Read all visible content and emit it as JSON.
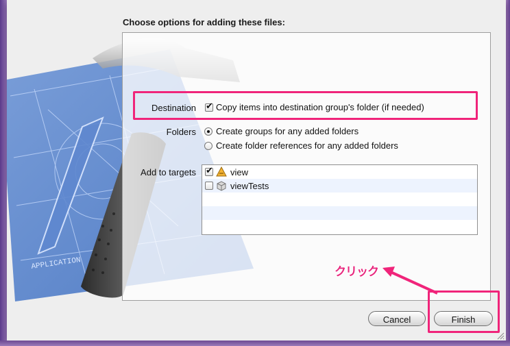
{
  "dialog": {
    "heading": "Choose options for adding these files:"
  },
  "destination": {
    "label": "Destination",
    "checkbox_label": "Copy items into destination group's folder (if needed)",
    "checked": true
  },
  "folders": {
    "label": "Folders",
    "options": [
      {
        "label": "Create groups for any added folders",
        "selected": true
      },
      {
        "label": "Create folder references for any added folders",
        "selected": false
      }
    ]
  },
  "targets": {
    "label": "Add to targets",
    "items": [
      {
        "name": "view",
        "checked": true,
        "icon": "app-target-icon"
      },
      {
        "name": "viewTests",
        "checked": false,
        "icon": "test-bundle-icon"
      }
    ]
  },
  "buttons": {
    "cancel": "Cancel",
    "finish": "Finish"
  },
  "annotation": {
    "text": "クリック",
    "color": "#f0247a"
  },
  "background_art": {
    "blueprint_text": "APPLICATION"
  }
}
